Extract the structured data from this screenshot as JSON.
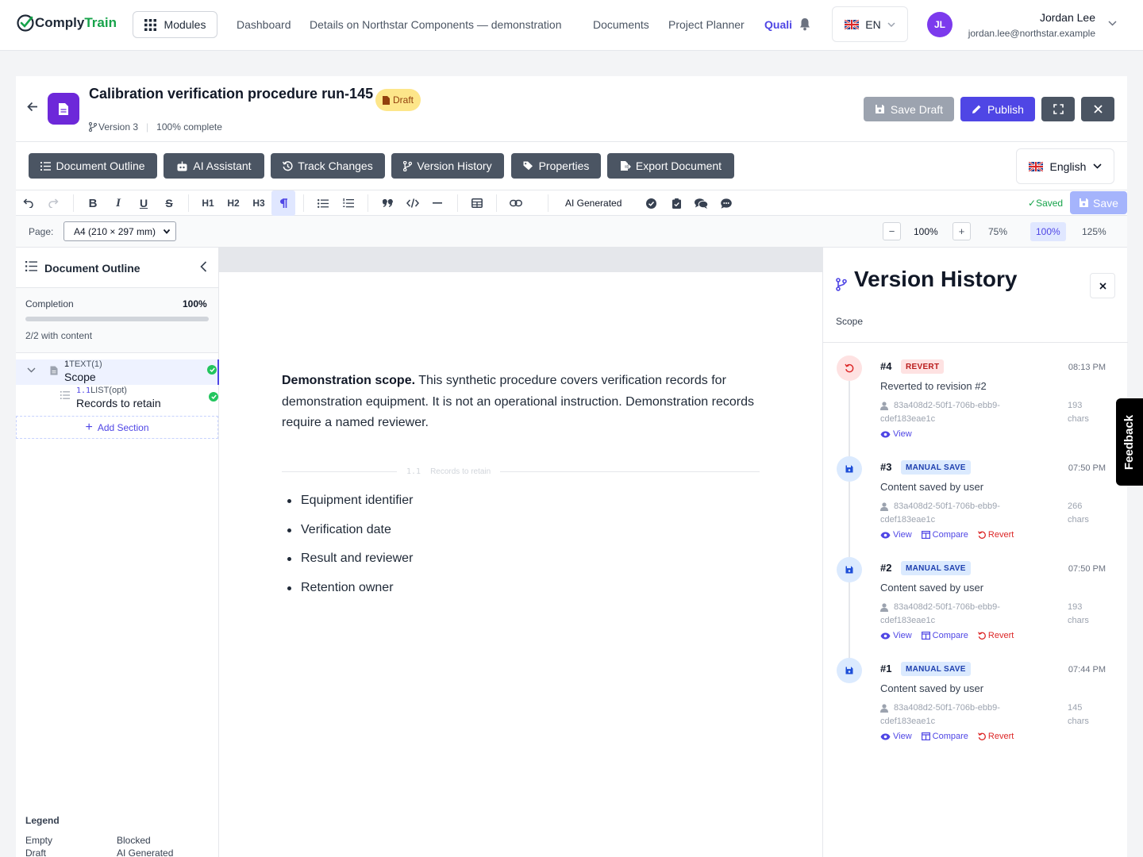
{
  "app": {
    "logo_part1": "Comply",
    "logo_part2": "Train",
    "modules_label": "Modules",
    "nav": [
      "Dashboard",
      "Details on Northstar Components — demonstration",
      "Documents",
      "Project Planner",
      "Quali"
    ],
    "language": "EN",
    "user": {
      "initials": "JL",
      "name": "Jordan Lee",
      "email": "jordan.lee@northstar.example"
    },
    "accent": "#4f46e5",
    "brand_green": "#16a34a"
  },
  "doc": {
    "title": "Calibration verification procedure run-145",
    "status": "Draft",
    "version": "Version 3",
    "progress": "100% complete",
    "save_draft_label": "Save Draft",
    "publish_label": "Publish"
  },
  "panels": {
    "buttons": [
      "Document Outline",
      "AI Assistant",
      "Track Changes",
      "Version History",
      "Properties",
      "Export Document"
    ],
    "language": "English"
  },
  "toolbar": {
    "h1": "H1",
    "h2": "H2",
    "h3": "H3",
    "ai_generated": "AI Generated",
    "saved": "Saved",
    "save_label": "Save"
  },
  "page": {
    "label": "Page:",
    "size": "A4 (210 × 297 mm)",
    "zoom": "100%",
    "zoom_options": [
      "75%",
      "100%",
      "125%"
    ],
    "zoom_selected": "100%"
  },
  "outline": {
    "title": "Document Outline",
    "completion_label": "Completion",
    "completion_value": "100%",
    "completion_fraction": 1.0,
    "with_content": "2/2 with content",
    "sections": [
      {
        "num": "1",
        "type": "TEXT(1)",
        "name": "Scope"
      },
      {
        "num": "1.1",
        "type": "LIST(opt)",
        "name": "Records to retain"
      }
    ],
    "add_section": "Add Section",
    "legend_title": "Legend",
    "legend": [
      "Empty",
      "Blocked",
      "Draft",
      "AI Generated"
    ]
  },
  "content": {
    "para_bold": "Demonstration scope.",
    "para_text": " This synthetic procedure covers verification records for demonstration equipment. It is not an operational instruction. Demonstration records require a named reviewer.",
    "divider_num": "1.1",
    "divider_label": "Records to retain",
    "bullets": [
      "Equipment identifier",
      "Verification date",
      "Result and reviewer",
      "Retention owner"
    ]
  },
  "version_history": {
    "title": "Version History",
    "subtitle": "Scope",
    "revisions": [
      {
        "num": "#4",
        "badge": "REVERT",
        "kind": "revert",
        "time": "08:13 PM",
        "desc": "Reverted to revision #2",
        "user_a": "83a408d2-50f1-706b-ebb9-",
        "user_b": "cdef183eae1c",
        "chars_a": "193",
        "chars_b": "chars",
        "actions": [
          "View"
        ]
      },
      {
        "num": "#3",
        "badge": "MANUAL SAVE",
        "kind": "manual",
        "time": "07:50 PM",
        "desc": "Content saved by user",
        "user_a": "83a408d2-50f1-706b-ebb9-",
        "user_b": "cdef183eae1c",
        "chars_a": "266",
        "chars_b": "chars",
        "actions": [
          "View",
          "Compare",
          "Revert"
        ]
      },
      {
        "num": "#2",
        "badge": "MANUAL SAVE",
        "kind": "manual",
        "time": "07:50 PM",
        "desc": "Content saved by user",
        "user_a": "83a408d2-50f1-706b-ebb9-",
        "user_b": "cdef183eae1c",
        "chars_a": "193",
        "chars_b": "chars",
        "actions": [
          "View",
          "Compare",
          "Revert"
        ]
      },
      {
        "num": "#1",
        "badge": "MANUAL SAVE",
        "kind": "manual",
        "time": "07:44 PM",
        "desc": "Content saved by user",
        "user_a": "83a408d2-50f1-706b-ebb9-",
        "user_b": "cdef183eae1c",
        "chars_a": "145",
        "chars_b": "chars",
        "actions": [
          "View",
          "Compare",
          "Revert"
        ]
      }
    ]
  },
  "feedback_label": "Feedback"
}
